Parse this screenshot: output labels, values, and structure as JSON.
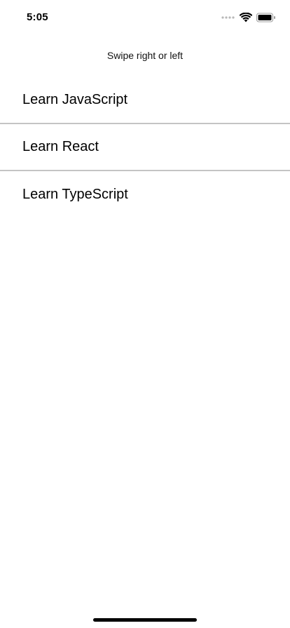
{
  "status_bar": {
    "time": "5:05",
    "icons": [
      "signal-dots-icon",
      "wifi-icon",
      "battery-icon"
    ]
  },
  "header": {
    "hint": "Swipe right or left"
  },
  "list": {
    "items": [
      {
        "label": "Learn JavaScript"
      },
      {
        "label": "Learn React"
      },
      {
        "label": "Learn TypeScript"
      }
    ]
  },
  "colors": {
    "background": "#ffffff",
    "text": "#000000",
    "divider": "#c4c4c4"
  }
}
